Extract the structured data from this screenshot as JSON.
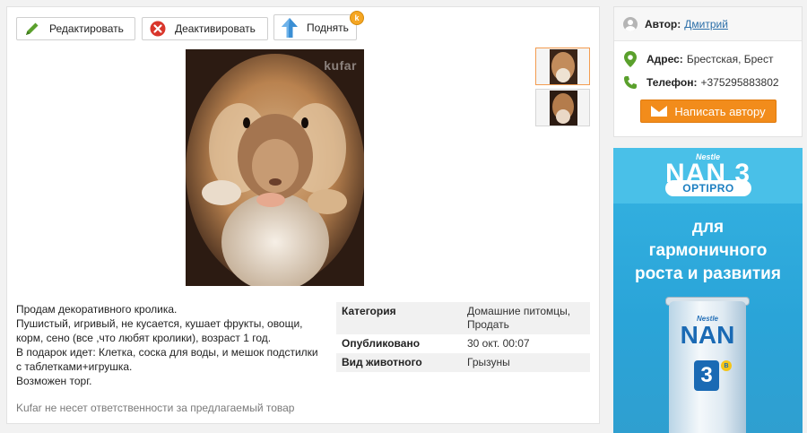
{
  "toolbar": {
    "edit_label": "Редактировать",
    "deactivate_label": "Деактивировать",
    "raise_label": "Поднять",
    "raise_badge": "k"
  },
  "listing": {
    "photo_watermark": "kufar",
    "description_lines": [
      "Продам декоративного кролика.",
      "Пушистый, игривый, не кусается, кушает фрукты, овощи,",
      "корм, сено (все ,что любят кролики), возраст 1 год.",
      "В подарок идет: Клетка, соска для воды, и мешок подстилки",
      "с таблетками+игрушка.",
      "Возможен торг."
    ],
    "disclaimer": "Kufar не несет ответственности за предлагаемый товар",
    "specs": [
      {
        "key": "Категория",
        "value": "Домашние питомцы, Продать"
      },
      {
        "key": "Опубликовано",
        "value": "30 окт. 00:07"
      },
      {
        "key": "Вид животного",
        "value": "Грызуны"
      }
    ]
  },
  "seller": {
    "author_label": "Автор:",
    "author_name": "Дмитрий",
    "address_label": "Адрес:",
    "address_value": "Брестская, Брест",
    "phone_label": "Телефон:",
    "phone_value": "+375295883802",
    "write_button": "Написать автору"
  },
  "ad": {
    "brand_small": "Nestle",
    "brand_name": "NAN 3",
    "sub_brand": "OPTIPRO",
    "tagline_lines": [
      "для",
      "гармоничного",
      "роста и развития"
    ],
    "can_brand_small": "Nestle",
    "can_brand": "NAN",
    "can_number": "3",
    "can_badge": "B"
  },
  "colors": {
    "accent_orange": "#f28c1b",
    "link_blue": "#2a6ea8",
    "icon_green": "#5aa02c",
    "icon_red": "#d9362b",
    "icon_blue": "#3b8fd4"
  }
}
